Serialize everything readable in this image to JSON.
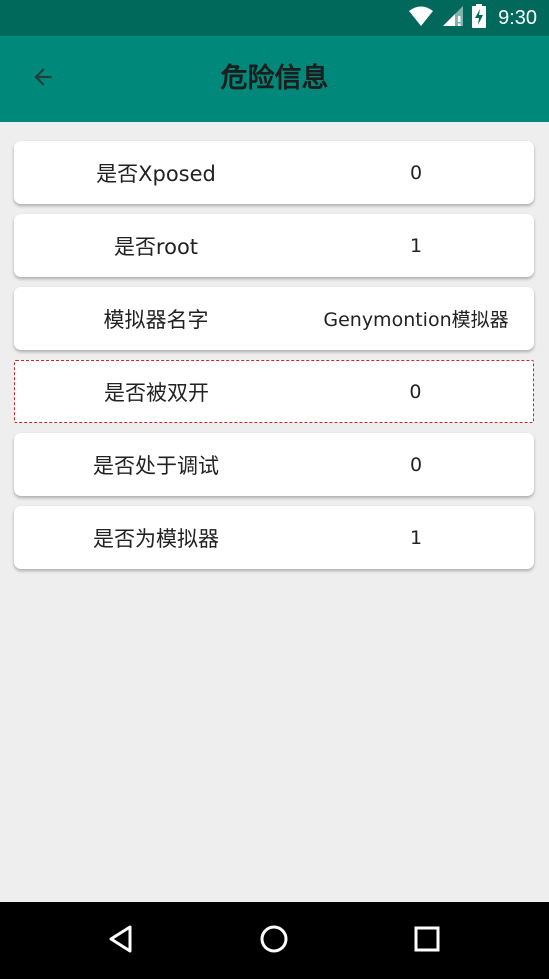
{
  "status_bar": {
    "time": "9:30",
    "icons": [
      "wifi-icon",
      "signal-icon",
      "battery-charging-icon"
    ]
  },
  "app_bar": {
    "title": "危险信息",
    "back_icon": "arrow-back-icon"
  },
  "items": [
    {
      "label": "是否Xposed",
      "value": "0"
    },
    {
      "label": "是否root",
      "value": "1"
    },
    {
      "label": "模拟器名字",
      "value": "Genymontion模拟器"
    },
    {
      "label": "是否被双开",
      "value": "0"
    },
    {
      "label": "是否处于调试",
      "value": "0"
    },
    {
      "label": "是否为模拟器",
      "value": "1"
    }
  ],
  "nav_bar": {
    "icons": [
      "back-triangle-icon",
      "home-circle-icon",
      "recents-square-icon"
    ]
  },
  "colors": {
    "status_bar": "#00695c",
    "app_bar": "#00897b",
    "background": "#eeeeee",
    "card": "#ffffff",
    "focus_outline": "#c62828"
  }
}
